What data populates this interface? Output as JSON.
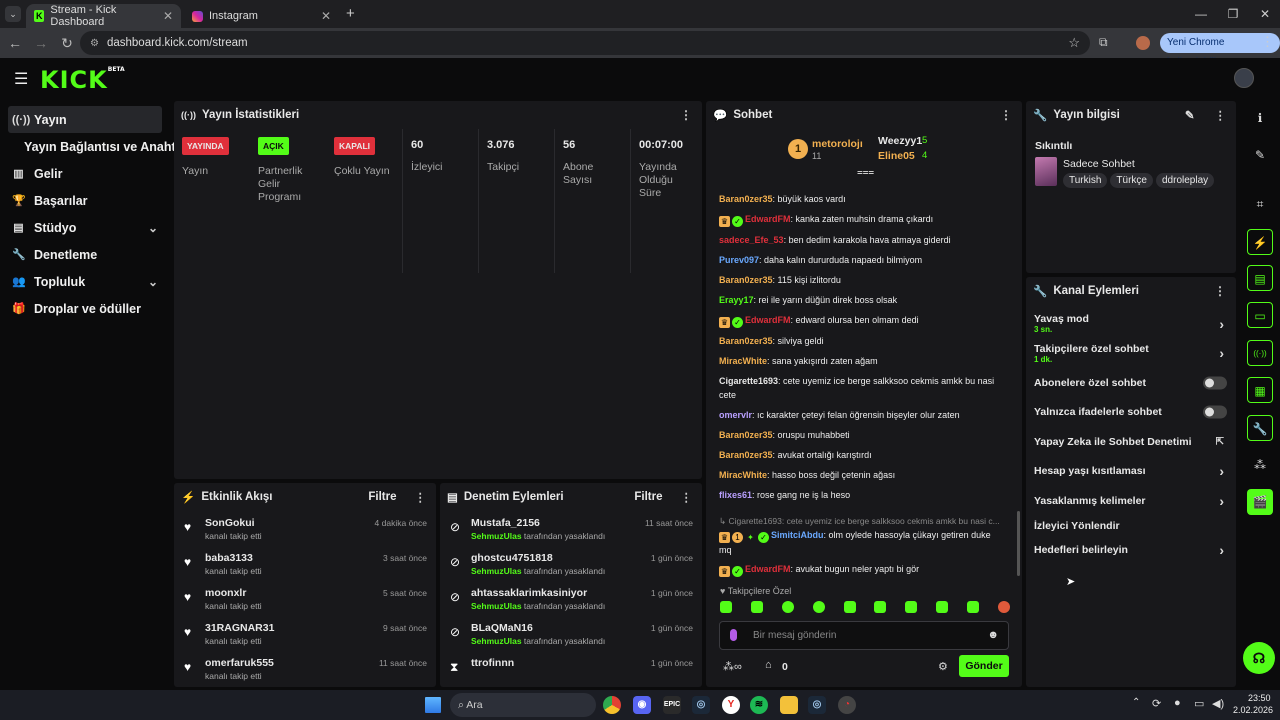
{
  "browser": {
    "tabs": [
      {
        "label": "Stream - Kick Dashboard",
        "active": true
      },
      {
        "label": "Instagram",
        "active": false
      }
    ],
    "url": "dashboard.kick.com/stream",
    "update_label": "Yeni Chrome kullanılabilir"
  },
  "app": {
    "logo": "KICK",
    "logo_badge": "BETA"
  },
  "sidebar": {
    "items": [
      {
        "label": "Yayın",
        "icon": "broadcast-icon"
      },
      {
        "label": "Yayın Bağlantısı ve Anahtarı",
        "icon": ""
      },
      {
        "label": "Gelir",
        "icon": "chart-icon"
      },
      {
        "label": "Başarılar",
        "icon": "trophy-icon"
      },
      {
        "label": "Stüdyo",
        "icon": "studio-icon"
      },
      {
        "label": "Denetleme",
        "icon": "wrench-icon"
      },
      {
        "label": "Topluluk",
        "icon": "community-icon"
      },
      {
        "label": "Droplar ve ödüller",
        "icon": "gift-icon"
      }
    ]
  },
  "stats": {
    "title": "Yayın İstatistikleri",
    "cards": [
      {
        "badge": "YAYINDA",
        "label": "Yayın",
        "color": "#e0303b"
      },
      {
        "badge": "AÇIK",
        "label": "Partnerlik Gelir Programı",
        "color": "#53fc18"
      },
      {
        "badge": "KAPALI",
        "label": "Çoklu Yayın",
        "color": "#e0303b"
      },
      {
        "value": "60",
        "label": "İzleyici"
      },
      {
        "value": "3.076",
        "label": "Takipçi"
      },
      {
        "value": "56",
        "label": "Abone Sayısı"
      },
      {
        "value": "00:07:00",
        "label": "Yayında Olduğu Süre"
      }
    ]
  },
  "activity": {
    "title": "Etkinlik Akışı",
    "filter": "Filtre",
    "items": [
      {
        "name": "SonGokui",
        "sub": "kanalı takip etti",
        "time": "4 dakika önce"
      },
      {
        "name": "baba3133",
        "sub": "kanalı takip etti",
        "time": "3 saat önce"
      },
      {
        "name": "moonxlr",
        "sub": "kanalı takip etti",
        "time": "5 saat önce"
      },
      {
        "name": "31RAGNAR31",
        "sub": "kanalı takip etti",
        "time": "9 saat önce"
      },
      {
        "name": "omerfaruk555",
        "sub": "kanalı takip etti",
        "time": "11 saat önce"
      }
    ]
  },
  "moderation": {
    "title": "Denetim Eylemleri",
    "filter": "Filtre",
    "items": [
      {
        "name": "Mustafa_2156",
        "by": "SehmuzUlas",
        "sub": "tarafından yasaklandı",
        "time": "11 saat önce"
      },
      {
        "name": "ghostcu4751818",
        "by": "SehmuzUlas",
        "sub": "tarafından yasaklandı",
        "time": "1 gün önce"
      },
      {
        "name": "ahtassaklarimkasiniyor",
        "by": "SehmuzUlas",
        "sub": "tarafından yasaklandı",
        "time": "1 gün önce"
      },
      {
        "name": "BLaQMaN16",
        "by": "SehmuzUlas",
        "sub": "tarafından yasaklandı",
        "time": "1 gün önce"
      },
      {
        "name": "ttrofinnn",
        "by": "",
        "sub": "",
        "time": "1 gün önce"
      }
    ]
  },
  "chat": {
    "title": "Sohbet",
    "leaders": {
      "first": {
        "name": "metorolojı",
        "count": "11"
      },
      "second": {
        "name": "Weezyy1",
        "count": "5"
      },
      "third": {
        "name": "Eline05",
        "count": "4"
      }
    },
    "messages": [
      {
        "user": "Baran0zer35",
        "text": ": büyük kaos vardı",
        "color": "ca",
        "badges": []
      },
      {
        "user": "EdwardFM",
        "text": ": kanka zaten muhsin drama çıkardı",
        "color": "cr",
        "badges": [
          "crown",
          "verified"
        ]
      },
      {
        "user": "sadece_Efe_53",
        "text": ": ben dedim karakola hava atmaya giderdi",
        "color": "cr",
        "badges": []
      },
      {
        "user": "Purev097",
        "text": ": daha kalın dururduda napaedı bilmiyom",
        "color": "cb",
        "badges": []
      },
      {
        "user": "Baran0zer35",
        "text": ": 115 kişi izlitordu",
        "color": "ca",
        "badges": []
      },
      {
        "user": "Erayy17",
        "text": ": rei ile yarın düğün direk boss olsak",
        "color": "cg",
        "badges": []
      },
      {
        "user": "EdwardFM",
        "text": ": edward olursa ben olmam dedi",
        "color": "cr",
        "badges": [
          "crown",
          "verified"
        ]
      },
      {
        "user": "Baran0zer35",
        "text": ": silviya geldi",
        "color": "ca",
        "badges": []
      },
      {
        "user": "MiracWhite",
        "text": ": sana yakışırdı zaten ağam",
        "color": "ca",
        "badges": []
      },
      {
        "user": "Cigarette1693",
        "text": ": cete uyemiz ice berge salkksoo cekmis amkk bu nasi cete",
        "color": "cw",
        "badges": []
      },
      {
        "user": "omervlr",
        "text": ": ıc karakter çeteyi felan öğrensin bişeyler olur zaten",
        "color": "cv",
        "badges": []
      },
      {
        "user": "Baran0zer35",
        "text": ": oruspu muhabbeti",
        "color": "ca",
        "badges": []
      },
      {
        "user": "Baran0zer35",
        "text": ": avukat ortalığı karıştırdı",
        "color": "ca",
        "badges": []
      },
      {
        "user": "MiracWhite",
        "text": ": hasso boss değil çetenin ağası",
        "color": "ca",
        "badges": []
      },
      {
        "user": "flixes61",
        "text": ": rose gang ne iş la heso",
        "color": "cv",
        "badges": []
      }
    ],
    "reply_preview": "Cigarette1693: cete uyemiz ice berge salkksoo cekmis amkk bu nasi c...",
    "reply_msg": {
      "user": "SimitciAbdu",
      "text": ": olm oylede hassoyla çükayı getiren duke mq"
    },
    "last_msg": {
      "user": "EdwardFM",
      "text": ": avukat bugun neler yaptı bi gör"
    },
    "followers_only": "Takipçilere Özel",
    "input_placeholder": "Bir mesaj gönderin",
    "points": "0",
    "send_label": "Gönder"
  },
  "stream_info": {
    "title": "Yayın bilgisi",
    "stream_title": "Sıkıntılı",
    "category": "Sadece Sohbet",
    "tags": [
      "Turkish",
      "Türkçe",
      "ddroleplay"
    ]
  },
  "channel_actions": {
    "title": "Kanal Eylemleri",
    "items": [
      {
        "label": "Yavaş mod",
        "sub": "3 sn.",
        "type": "arrow"
      },
      {
        "label": "Takipçilere özel sohbet",
        "sub": "1 dk.",
        "type": "arrow"
      },
      {
        "label": "Abonelere özel sohbet",
        "sub": "",
        "type": "toggle"
      },
      {
        "label": "Yalnızca ifadelerle sohbet",
        "sub": "",
        "type": "toggle"
      },
      {
        "label": "Yapay Zeka ile Sohbet Denetimi",
        "sub": "",
        "type": "external"
      },
      {
        "label": "Hesap yaşı kısıtlaması",
        "sub": "",
        "type": "arrow"
      },
      {
        "label": "Yasaklanmış kelimeler",
        "sub": "",
        "type": "arrow"
      },
      {
        "label": "İzleyici Yönlendir",
        "sub": "",
        "type": "none"
      },
      {
        "label": "Hedefleri belirleyin",
        "sub": "",
        "type": "arrow"
      }
    ]
  },
  "taskbar": {
    "search": "Ara",
    "time": "23:50",
    "date": "2.02.2026"
  },
  "colors": {
    "accent": "#53fc18",
    "panel": "#18181b",
    "background": "#0b0b0c",
    "live": "#e0303b"
  }
}
